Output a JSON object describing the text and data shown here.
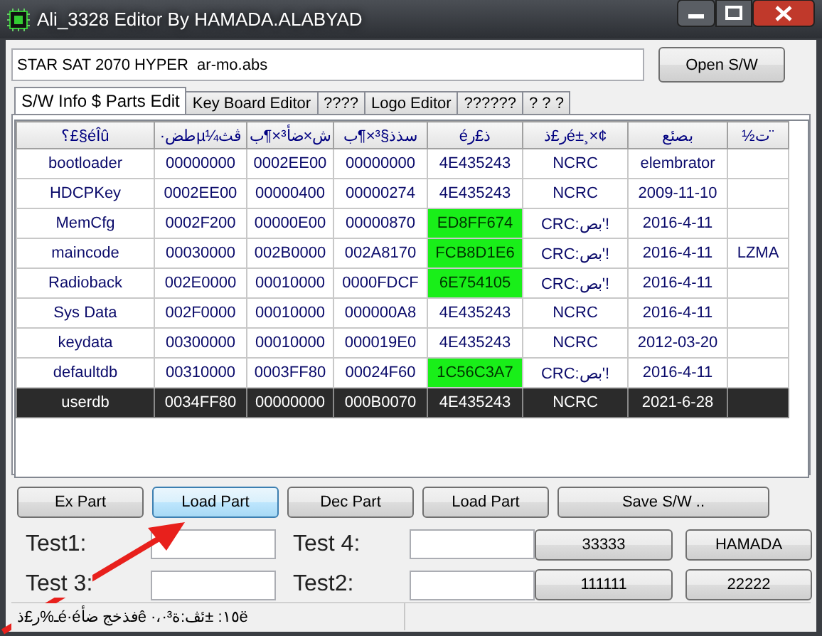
{
  "window": {
    "title": "Ali_3328 Editor By HAMADA.ALABYAD"
  },
  "file_field": {
    "value": "STAR SAT 2070 HYPER  ar-mo.abs"
  },
  "open_button": "Open S/W",
  "tabs": [
    {
      "label": "S/W Info $ Parts Edit",
      "selected": true
    },
    {
      "label": "Key Board Editor",
      "selected": false
    },
    {
      "label": "????",
      "selected": false
    },
    {
      "label": "Logo Editor",
      "selected": false
    },
    {
      "label": "??????",
      "selected": false
    },
    {
      "label": "? ? ?",
      "selected": false
    }
  ],
  "table": {
    "columns": [
      "؟£§éÎû",
      "·طضµ¼ڤث",
      "ش×ضأ³×¶ب",
      "سذذ§³×¶ب",
      "éذ£ر",
      "ر£ذé±¸×¢",
      "بصئع",
      "½ت¨"
    ],
    "rows": [
      {
        "selected": false,
        "highlighted": false,
        "cells": [
          "bootloader",
          "00000000",
          "0002EE00",
          "00000000",
          "4E435243",
          "NCRC",
          "elembrator",
          ""
        ]
      },
      {
        "selected": false,
        "highlighted": false,
        "cells": [
          "HDCPKey",
          "0002EE00",
          "00000400",
          "00000274",
          "4E435243",
          "NCRC",
          "2009-11-10",
          ""
        ]
      },
      {
        "selected": false,
        "highlighted": true,
        "cells": [
          "MemCfg",
          "0002F200",
          "00000E00",
          "00000870",
          "ED8FF674",
          "CRC:بص'!",
          "2016-4-11",
          ""
        ]
      },
      {
        "selected": false,
        "highlighted": true,
        "cells": [
          "maincode",
          "00030000",
          "002B0000",
          "002A8170",
          "FCB8D1E6",
          "CRC:بص'!",
          "2016-4-11",
          "LZMA"
        ]
      },
      {
        "selected": false,
        "highlighted": true,
        "cells": [
          "Radioback",
          "002E0000",
          "00010000",
          "0000FDCF",
          "6E754105",
          "CRC:بص'!",
          "2016-4-11",
          ""
        ]
      },
      {
        "selected": false,
        "highlighted": false,
        "cells": [
          "Sys Data",
          "002F0000",
          "00010000",
          "000000A8",
          "4E435243",
          "NCRC",
          "2016-4-11",
          ""
        ]
      },
      {
        "selected": false,
        "highlighted": false,
        "cells": [
          "keydata",
          "00300000",
          "00010000",
          "000019E0",
          "4E435243",
          "NCRC",
          "2012-03-20",
          ""
        ]
      },
      {
        "selected": false,
        "highlighted": true,
        "cells": [
          "defaultdb",
          "00310000",
          "0003FF80",
          "00024F60",
          "1C56C3A7",
          "CRC:بص'!",
          "2016-4-11",
          ""
        ]
      },
      {
        "selected": true,
        "highlighted": false,
        "cells": [
          "userdb",
          "0034FF80",
          "00000000",
          "000B0070",
          "4E435243",
          "NCRC",
          "2021-6-28",
          ""
        ]
      }
    ]
  },
  "part_buttons": [
    {
      "label": "Ex Part",
      "hovered": false
    },
    {
      "label": "Load Part",
      "hovered": true
    },
    {
      "label": "Dec Part",
      "hovered": false
    },
    {
      "label": "Load Part",
      "hovered": false
    },
    {
      "label": "Save S/W ..",
      "hovered": false
    }
  ],
  "test_fields": [
    {
      "label": "Test1:"
    },
    {
      "label": "Test 4:"
    },
    {
      "label": "Test 3:"
    },
    {
      "label": "Test2:"
    }
  ],
  "side_buttons": [
    "33333",
    "HAMADA",
    "111111",
    "22222"
  ],
  "status_bar": "ـ%ر£ذé·éفذخج ضأê ·،·١٥: ±ئڤ:ة³ë"
}
